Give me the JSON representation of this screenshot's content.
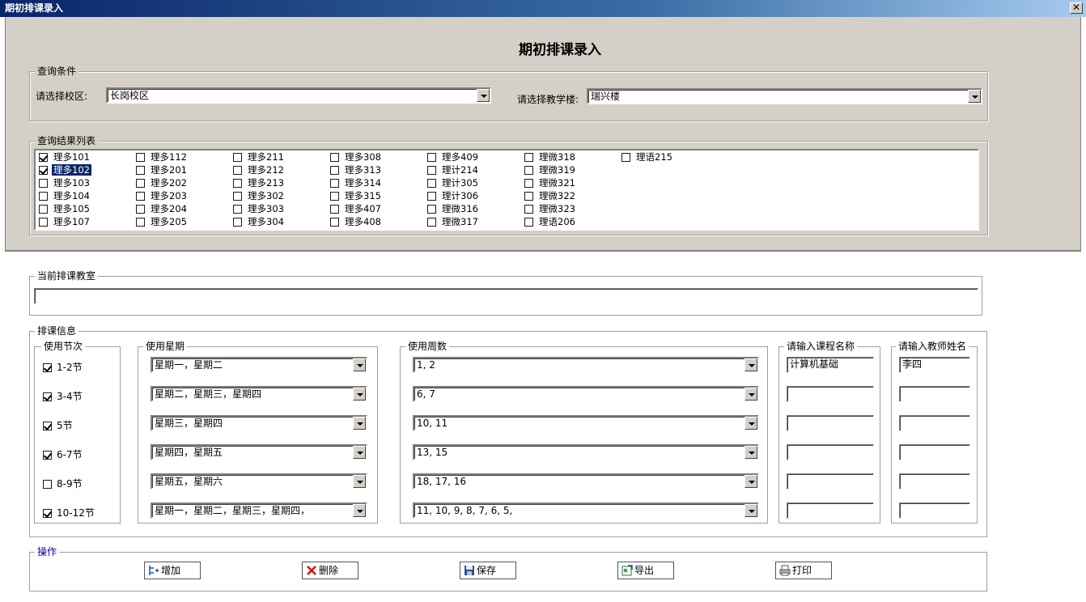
{
  "window": {
    "title": "期初排课录入",
    "close_glyph": "✕"
  },
  "form_title": "期初排课录入",
  "query": {
    "legend": "查询条件",
    "campus_label": "请选择校区:",
    "campus_value": "长岗校区",
    "building_label": "请选择教学楼:",
    "building_value": "瑞兴楼"
  },
  "results": {
    "legend": "查询结果列表",
    "columns": [
      [
        {
          "name": "理多101",
          "checked": true
        },
        {
          "name": "理多102",
          "checked": true,
          "selected": true
        },
        {
          "name": "理多103",
          "checked": false
        },
        {
          "name": "理多104",
          "checked": false
        },
        {
          "name": "理多105",
          "checked": false
        },
        {
          "name": "理多107",
          "checked": false
        }
      ],
      [
        {
          "name": "理多112",
          "checked": false
        },
        {
          "name": "理多201",
          "checked": false
        },
        {
          "name": "理多202",
          "checked": false
        },
        {
          "name": "理多203",
          "checked": false
        },
        {
          "name": "理多204",
          "checked": false
        },
        {
          "name": "理多205",
          "checked": false
        }
      ],
      [
        {
          "name": "理多211",
          "checked": false
        },
        {
          "name": "理多212",
          "checked": false
        },
        {
          "name": "理多213",
          "checked": false
        },
        {
          "name": "理多302",
          "checked": false
        },
        {
          "name": "理多303",
          "checked": false
        },
        {
          "name": "理多304",
          "checked": false
        }
      ],
      [
        {
          "name": "理多308",
          "checked": false
        },
        {
          "name": "理多313",
          "checked": false
        },
        {
          "name": "理多314",
          "checked": false
        },
        {
          "name": "理多315",
          "checked": false
        },
        {
          "name": "理多407",
          "checked": false
        },
        {
          "name": "理多408",
          "checked": false
        }
      ],
      [
        {
          "name": "理多409",
          "checked": false
        },
        {
          "name": "理计214",
          "checked": false
        },
        {
          "name": "理计305",
          "checked": false
        },
        {
          "name": "理计306",
          "checked": false
        },
        {
          "name": "理微316",
          "checked": false
        },
        {
          "name": "理微317",
          "checked": false
        }
      ],
      [
        {
          "name": "理微318",
          "checked": false
        },
        {
          "name": "理微319",
          "checked": false
        },
        {
          "name": "理微321",
          "checked": false
        },
        {
          "name": "理微322",
          "checked": false
        },
        {
          "name": "理微323",
          "checked": false
        },
        {
          "name": "理语206",
          "checked": false
        }
      ],
      [
        {
          "name": "理语215",
          "checked": false
        }
      ]
    ]
  },
  "current_room": {
    "legend": "当前排课教室",
    "value": ""
  },
  "schedule": {
    "legend": "排课信息",
    "periods_legend": "使用节次",
    "weekdays_legend": "使用星期",
    "weeks_legend": "使用周数",
    "course_legend": "请输入课程名称",
    "teacher_legend": "请输入教师姓名",
    "rows": [
      {
        "period": "1-2节",
        "checked": true,
        "weekdays": "星期一，星期二",
        "weeks": "1, 2",
        "course": "计算机基础",
        "teacher": "李四"
      },
      {
        "period": "3-4节",
        "checked": true,
        "weekdays": "星期二，星期三，星期四",
        "weeks": "6, 7",
        "course": "",
        "teacher": ""
      },
      {
        "period": "5节",
        "checked": true,
        "weekdays": "星期三，星期四",
        "weeks": "10, 11",
        "course": "",
        "teacher": ""
      },
      {
        "period": "6-7节",
        "checked": true,
        "weekdays": "星期四，星期五",
        "weeks": "13, 15",
        "course": "",
        "teacher": ""
      },
      {
        "period": "8-9节",
        "checked": false,
        "weekdays": "星期五，星期六",
        "weeks": "18, 17, 16",
        "course": "",
        "teacher": ""
      },
      {
        "period": "10-12节",
        "checked": true,
        "weekdays": "星期一，星期二，星期三，星期四，",
        "weeks": "11, 10, 9, 8, 7, 6, 5,",
        "course": "",
        "teacher": ""
      }
    ]
  },
  "operations": {
    "legend": "操作",
    "buttons": [
      {
        "label": "增加",
        "icon": "add-icon"
      },
      {
        "label": "删除",
        "icon": "delete-icon"
      },
      {
        "label": "保存",
        "icon": "save-icon"
      },
      {
        "label": "导出",
        "icon": "export-icon"
      },
      {
        "label": "打印",
        "icon": "print-icon"
      }
    ]
  }
}
